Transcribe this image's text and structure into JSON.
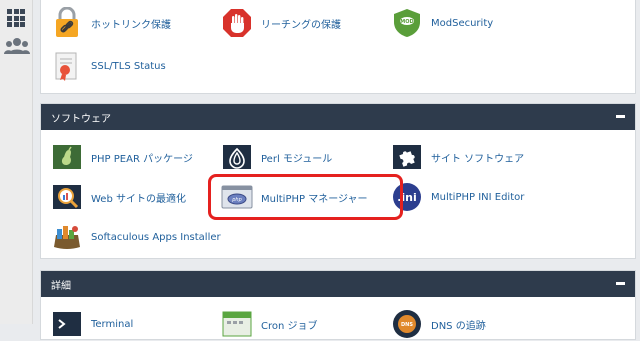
{
  "top_items": [
    {
      "label": "ホットリンク保護",
      "icon": "padlock-link-icon"
    },
    {
      "label": "リーチングの保護",
      "icon": "stop-hand-icon"
    },
    {
      "label": "ModSecurity",
      "icon": "mod-shield-icon"
    },
    {
      "label": "SSL/TLS Status",
      "icon": "ssl-certificate-icon"
    }
  ],
  "software": {
    "title": "ソフトウェア",
    "items": [
      {
        "label": "PHP PEAR パッケージ",
        "icon": "pear-package-icon"
      },
      {
        "label": "Perl モジュール",
        "icon": "perl-onion-icon"
      },
      {
        "label": "サイト ソフトウェア",
        "icon": "puzzle-icon"
      },
      {
        "label": "Web サイトの最適化",
        "icon": "magnifier-chart-icon"
      },
      {
        "label": "MultiPHP マネージャー",
        "icon": "php-window-icon"
      },
      {
        "label": "MultiPHP INI Editor",
        "icon": "ini-badge-icon"
      },
      {
        "label": "Softaculous Apps Installer",
        "icon": "softaculous-icon"
      }
    ]
  },
  "advanced": {
    "title": "詳細",
    "items": [
      {
        "label": "Terminal",
        "icon": "terminal-icon"
      },
      {
        "label": "Cron ジョブ",
        "icon": "calendar-icon"
      },
      {
        "label": "DNS の追跡",
        "icon": "dns-icon"
      }
    ]
  },
  "colors": {
    "header_bg": "#2e3b4c",
    "link": "#1f5f9b",
    "highlight": "#e5211f"
  }
}
